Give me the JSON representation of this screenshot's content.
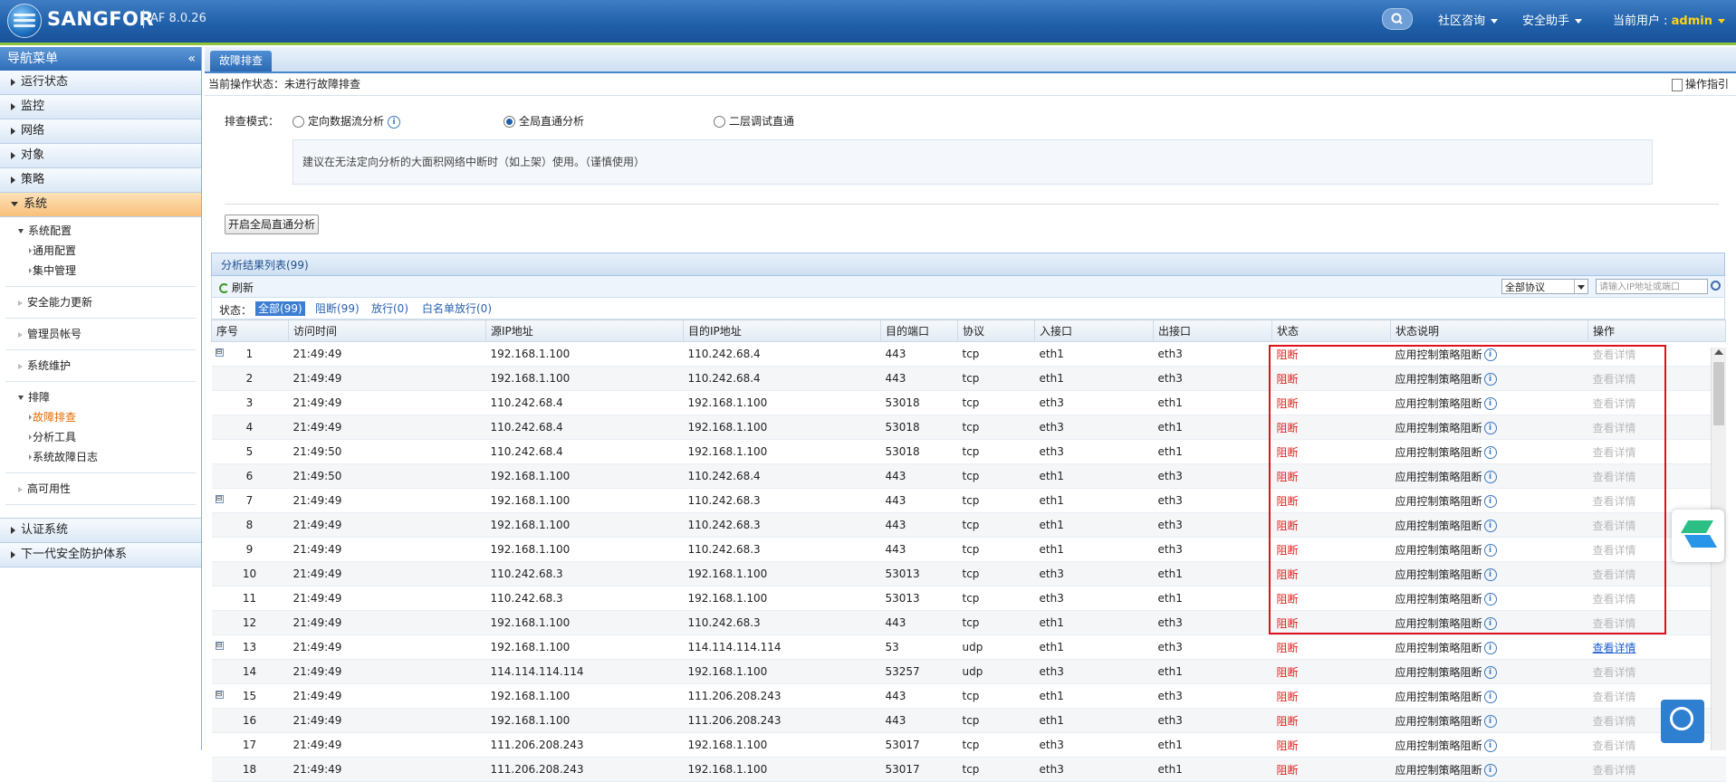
{
  "header": {
    "brand": "SANGFOR",
    "version": "AF 8.0.26",
    "menu_community": "社区咨询",
    "menu_security_assistant": "安全助手",
    "current_user_label": "当前用户 :",
    "current_user": "admin"
  },
  "sidebar": {
    "title": "导航菜单",
    "items": [
      {
        "label": "运行状态"
      },
      {
        "label": "监控"
      },
      {
        "label": "网络"
      },
      {
        "label": "对象"
      },
      {
        "label": "策略"
      },
      {
        "label": "系统"
      }
    ],
    "system": {
      "config": "系统配置",
      "general_config": "通用配置",
      "central_mgmt": "集中管理",
      "security_update": "安全能力更新",
      "admin_account": "管理员帐号",
      "system_maintenance": "系统维护",
      "troubleshoot": "排障",
      "fault_troubleshoot": "故障排查",
      "analysis_tools": "分析工具",
      "system_fault_log": "系统故障日志",
      "high_availability": "高可用性"
    },
    "bottom_items": [
      {
        "label": "认证系统"
      },
      {
        "label": "下一代安全防护体系"
      }
    ]
  },
  "main": {
    "tab": "故障排查",
    "status_line": "当前操作状态：未进行故障排查",
    "op_guide": "操作指引",
    "mode_label": "排查模式：",
    "modes": [
      {
        "label": "定向数据流分析",
        "checked": false
      },
      {
        "label": "全局直通分析",
        "checked": true
      },
      {
        "label": "二层调试直通",
        "checked": false
      }
    ],
    "hint": "建议在无法定向分析的大面积网络中断时（如上架）使用。（谨慎使用）",
    "start_button": "开启全局直通分析",
    "list_title": "分析结果列表(99)",
    "refresh": "刷新",
    "protocol_select": "全部协议",
    "ip_placeholder": "请输入IP地址或端口",
    "status_label": "状态：",
    "filters": [
      {
        "label": "全部(99)",
        "selected": true
      },
      {
        "label": "阻断(99)",
        "selected": false
      },
      {
        "label": "放行(0)",
        "selected": false
      },
      {
        "label": "白名单放行(0)",
        "selected": false
      }
    ],
    "columns": [
      "序号",
      "访问时间",
      "源IP地址",
      "目的IP地址",
      "目的端口",
      "协议",
      "入接口",
      "出接口",
      "状态",
      "状态说明",
      "操作"
    ],
    "rows": [
      {
        "seq": "1",
        "time": "21:49:49",
        "src": "192.168.1.100",
        "dst": "110.242.68.4",
        "port": "443",
        "proto": "tcp",
        "in": "eth1",
        "out": "eth3",
        "status": "阻断",
        "desc": "应用控制策略阻断",
        "op": "查看详情",
        "expander": "⊟"
      },
      {
        "seq": "2",
        "time": "21:49:49",
        "src": "192.168.1.100",
        "dst": "110.242.68.4",
        "port": "443",
        "proto": "tcp",
        "in": "eth1",
        "out": "eth3",
        "status": "阻断",
        "desc": "应用控制策略阻断",
        "op": "查看详情"
      },
      {
        "seq": "3",
        "time": "21:49:49",
        "src": "110.242.68.4",
        "dst": "192.168.1.100",
        "port": "53018",
        "proto": "tcp",
        "in": "eth3",
        "out": "eth1",
        "status": "阻断",
        "desc": "应用控制策略阻断",
        "op": "查看详情"
      },
      {
        "seq": "4",
        "time": "21:49:49",
        "src": "110.242.68.4",
        "dst": "192.168.1.100",
        "port": "53018",
        "proto": "tcp",
        "in": "eth3",
        "out": "eth1",
        "status": "阻断",
        "desc": "应用控制策略阻断",
        "op": "查看详情"
      },
      {
        "seq": "5",
        "time": "21:49:50",
        "src": "110.242.68.4",
        "dst": "192.168.1.100",
        "port": "53018",
        "proto": "tcp",
        "in": "eth3",
        "out": "eth1",
        "status": "阻断",
        "desc": "应用控制策略阻断",
        "op": "查看详情"
      },
      {
        "seq": "6",
        "time": "21:49:50",
        "src": "192.168.1.100",
        "dst": "110.242.68.4",
        "port": "443",
        "proto": "tcp",
        "in": "eth1",
        "out": "eth3",
        "status": "阻断",
        "desc": "应用控制策略阻断",
        "op": "查看详情"
      },
      {
        "seq": "7",
        "time": "21:49:49",
        "src": "192.168.1.100",
        "dst": "110.242.68.3",
        "port": "443",
        "proto": "tcp",
        "in": "eth1",
        "out": "eth3",
        "status": "阻断",
        "desc": "应用控制策略阻断",
        "op": "查看详情",
        "expander": "⊟"
      },
      {
        "seq": "8",
        "time": "21:49:49",
        "src": "192.168.1.100",
        "dst": "110.242.68.3",
        "port": "443",
        "proto": "tcp",
        "in": "eth1",
        "out": "eth3",
        "status": "阻断",
        "desc": "应用控制策略阻断",
        "op": "查看详情"
      },
      {
        "seq": "9",
        "time": "21:49:49",
        "src": "192.168.1.100",
        "dst": "110.242.68.3",
        "port": "443",
        "proto": "tcp",
        "in": "eth1",
        "out": "eth3",
        "status": "阻断",
        "desc": "应用控制策略阻断",
        "op": "查看详情"
      },
      {
        "seq": "10",
        "time": "21:49:49",
        "src": "110.242.68.3",
        "dst": "192.168.1.100",
        "port": "53013",
        "proto": "tcp",
        "in": "eth3",
        "out": "eth1",
        "status": "阻断",
        "desc": "应用控制策略阻断",
        "op": "查看详情"
      },
      {
        "seq": "11",
        "time": "21:49:49",
        "src": "110.242.68.3",
        "dst": "192.168.1.100",
        "port": "53013",
        "proto": "tcp",
        "in": "eth3",
        "out": "eth1",
        "status": "阻断",
        "desc": "应用控制策略阻断",
        "op": "查看详情"
      },
      {
        "seq": "12",
        "time": "21:49:49",
        "src": "192.168.1.100",
        "dst": "110.242.68.3",
        "port": "443",
        "proto": "tcp",
        "in": "eth1",
        "out": "eth3",
        "status": "阻断",
        "desc": "应用控制策略阻断",
        "op": "查看详情"
      },
      {
        "seq": "13",
        "time": "21:49:49",
        "src": "192.168.1.100",
        "dst": "114.114.114.114",
        "port": "53",
        "proto": "udp",
        "in": "eth1",
        "out": "eth3",
        "status": "阻断",
        "desc": "应用控制策略阻断",
        "op": "查看详情",
        "expander": "⊟",
        "link": true
      },
      {
        "seq": "14",
        "time": "21:49:49",
        "src": "114.114.114.114",
        "dst": "192.168.1.100",
        "port": "53257",
        "proto": "udp",
        "in": "eth3",
        "out": "eth1",
        "status": "阻断",
        "desc": "应用控制策略阻断",
        "op": "查看详情"
      },
      {
        "seq": "15",
        "time": "21:49:49",
        "src": "192.168.1.100",
        "dst": "111.206.208.243",
        "port": "443",
        "proto": "tcp",
        "in": "eth1",
        "out": "eth3",
        "status": "阻断",
        "desc": "应用控制策略阻断",
        "op": "查看详情",
        "expander": "⊟"
      },
      {
        "seq": "16",
        "time": "21:49:49",
        "src": "192.168.1.100",
        "dst": "111.206.208.243",
        "port": "443",
        "proto": "tcp",
        "in": "eth1",
        "out": "eth3",
        "status": "阻断",
        "desc": "应用控制策略阻断",
        "op": "查看详情"
      },
      {
        "seq": "17",
        "time": "21:49:49",
        "src": "111.206.208.243",
        "dst": "192.168.1.100",
        "port": "53017",
        "proto": "tcp",
        "in": "eth3",
        "out": "eth1",
        "status": "阻断",
        "desc": "应用控制策略阻断",
        "op": "查看详情"
      },
      {
        "seq": "18",
        "time": "21:49:49",
        "src": "111.206.208.243",
        "dst": "192.168.1.100",
        "port": "53017",
        "proto": "tcp",
        "in": "eth3",
        "out": "eth1",
        "status": "阻断",
        "desc": "应用控制策略阻断",
        "op": "查看详情"
      }
    ]
  },
  "colors": {
    "accent": "#2b69b3",
    "block_red": "#e02020",
    "highlight_box": "#e10f1e"
  }
}
